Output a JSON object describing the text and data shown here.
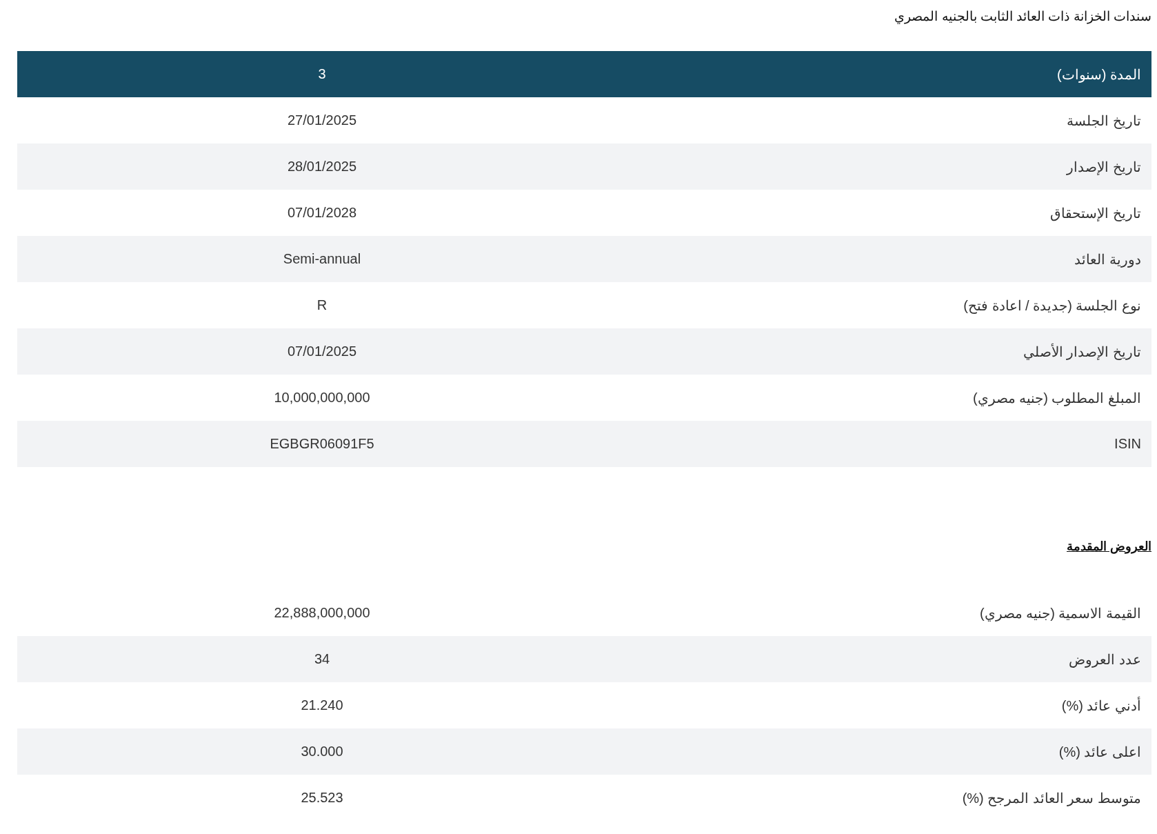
{
  "title": "سندات الخزانة ذات العائد الثابت بالجنيه المصري",
  "details_table": {
    "header": {
      "label": "المدة (سنوات)",
      "value": "3"
    },
    "rows": [
      {
        "label": "تاريخ الجلسة",
        "value": "27/01/2025"
      },
      {
        "label": "تاريخ الإصدار",
        "value": "28/01/2025"
      },
      {
        "label": "تاريخ الإستحقاق",
        "value": "07/01/2028"
      },
      {
        "label": "دورية العائد",
        "value": "Semi-annual"
      },
      {
        "label": "نوع الجلسة (جديدة / اعادة فتح)",
        "value": "R"
      },
      {
        "label": "تاريخ الإصدار الأصلي",
        "value": "07/01/2025"
      },
      {
        "label": "المبلغ المطلوب (جنيه مصري)",
        "value": "10,000,000,000"
      },
      {
        "label": "ISIN",
        "value": "EGBGR06091F5"
      }
    ]
  },
  "offers_heading": "العروض المقدمة",
  "offers_table": {
    "rows": [
      {
        "label": "القيمة الاسمية (جنيه مصري)",
        "value": "22,888,000,000"
      },
      {
        "label": "عدد العروض",
        "value": "34"
      },
      {
        "label": "أدني عائد (%)",
        "value": "21.240"
      },
      {
        "label": "اعلى عائد (%)",
        "value": "30.000"
      },
      {
        "label": "متوسط سعر العائد المرجح (%)",
        "value": "25.523"
      }
    ]
  }
}
